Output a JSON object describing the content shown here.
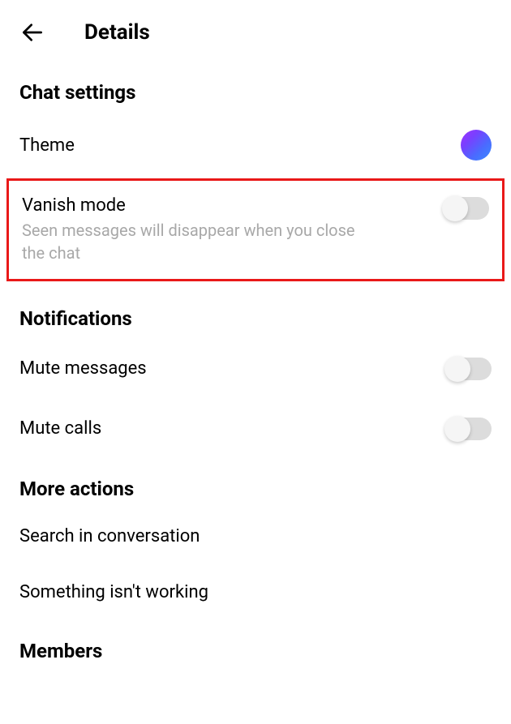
{
  "header": {
    "title": "Details"
  },
  "sections": {
    "chat_settings": {
      "header": "Chat settings",
      "theme": {
        "label": "Theme"
      },
      "vanish_mode": {
        "label": "Vanish mode",
        "sublabel": "Seen messages will disappear when you close the chat",
        "enabled": false
      }
    },
    "notifications": {
      "header": "Notifications",
      "mute_messages": {
        "label": "Mute messages",
        "enabled": false
      },
      "mute_calls": {
        "label": "Mute calls",
        "enabled": false
      }
    },
    "more_actions": {
      "header": "More actions",
      "search": {
        "label": "Search in conversation"
      },
      "report": {
        "label": "Something isn't working"
      }
    },
    "members": {
      "header": "Members"
    }
  }
}
